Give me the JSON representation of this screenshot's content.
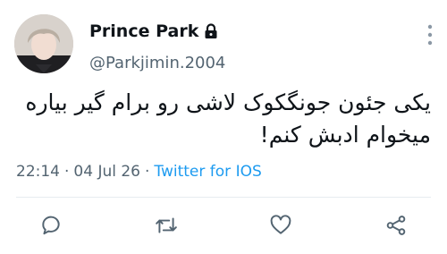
{
  "user": {
    "display_name": "Prince Park",
    "handle": "@Parkjimin.2004",
    "protected_icon": "lock-icon"
  },
  "tweet": {
    "lines": [
      "یکی جئون جونگکوک لاشی رو برام گیر بیاره",
      "میخوام ادبش کنم!"
    ],
    "time": "22:14",
    "date": "04 Jul 26",
    "source": "Twitter for IOS",
    "separator": "·"
  },
  "actions": [
    "reply-icon",
    "retweet-icon",
    "like-icon",
    "share-icon"
  ],
  "colors": {
    "link": "#1d9bf0",
    "muted": "#536471",
    "text": "#0f1419"
  }
}
